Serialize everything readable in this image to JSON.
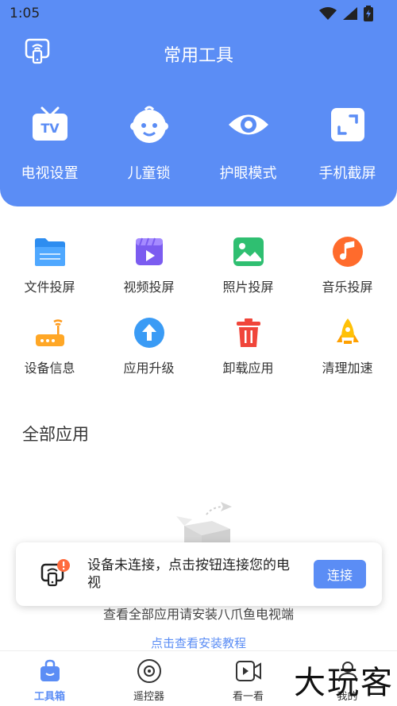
{
  "status": {
    "time": "1:05"
  },
  "header": {
    "title": "常用工具"
  },
  "hero_items": [
    {
      "label": "电视设置",
      "icon": "tv-icon"
    },
    {
      "label": "儿童锁",
      "icon": "child-face-icon"
    },
    {
      "label": "护眼模式",
      "icon": "eye-icon"
    },
    {
      "label": "手机截屏",
      "icon": "screenshot-icon"
    }
  ],
  "tools": [
    {
      "label": "文件投屏",
      "icon": "folder-icon"
    },
    {
      "label": "视频投屏",
      "icon": "video-icon"
    },
    {
      "label": "照片投屏",
      "icon": "photo-icon"
    },
    {
      "label": "音乐投屏",
      "icon": "music-icon"
    },
    {
      "label": "设备信息",
      "icon": "router-icon"
    },
    {
      "label": "应用升级",
      "icon": "upgrade-icon"
    },
    {
      "label": "卸载应用",
      "icon": "trash-icon"
    },
    {
      "label": "清理加速",
      "icon": "rocket-icon"
    }
  ],
  "section": {
    "title": "全部应用"
  },
  "notice": {
    "text": "设备未连接，点击按钮连接您的电视",
    "button": "连接"
  },
  "empty": {
    "hint": "查看全部应用请安装八爪鱼电视端",
    "link": "点击查看安装教程"
  },
  "tabs": [
    {
      "label": "工具箱",
      "icon": "toolbox-icon",
      "active": true
    },
    {
      "label": "遥控器",
      "icon": "remote-icon",
      "active": false
    },
    {
      "label": "看一看",
      "icon": "video-play-icon",
      "active": false
    },
    {
      "label": "我的",
      "icon": "profile-icon",
      "active": false
    }
  ],
  "watermark": "大玩客",
  "colors": {
    "accent": "#5b8df5",
    "alert": "#ff6b3d"
  }
}
